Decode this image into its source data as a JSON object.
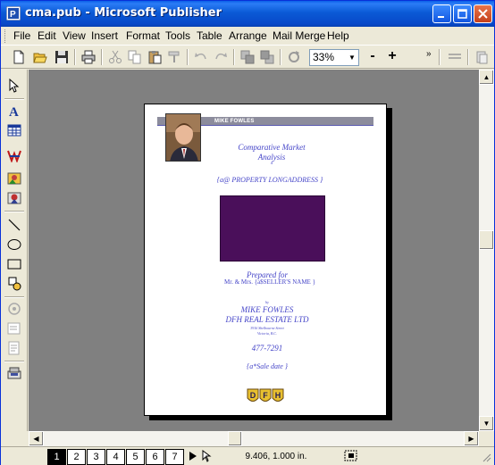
{
  "window": {
    "title": "cma.pub - Microsoft Publisher"
  },
  "menubar": {
    "items": [
      "File",
      "Edit",
      "View",
      "Insert",
      "Format",
      "Tools",
      "Table",
      "Arrange",
      "Mail Merge",
      "Help"
    ]
  },
  "toolbar": {
    "zoom": "33%",
    "zoom_out_label": "-",
    "zoom_in_label": "+"
  },
  "document": {
    "banner_name": "MIKE FOWLES",
    "title_line1": "Comparative Market",
    "title_line2": "Analysis",
    "title_line3": "4",
    "property_field": "{a@ PROPERTY LONGADDRESS        }",
    "prepared_for": "Prepared for",
    "seller_line": "Mr. & Mrs. {a$SELLER'S NAME              }",
    "by_label": "by",
    "agent_name": "MIKE FOWLES",
    "company": "DFH REAL ESTATE LTD",
    "address1": "3916 Shelbourne Street",
    "address2": "Victoria, B.C.",
    "phone": "477-7291",
    "sale_date": "{a*Sale date }",
    "logo_letters": [
      "D",
      "F",
      "H"
    ],
    "block_color": "#4a0f5a",
    "text_color": "#4545c8"
  },
  "statusbar": {
    "pages": [
      "1",
      "2",
      "3",
      "4",
      "5",
      "6",
      "7"
    ],
    "active_page": "1",
    "coordinates": "9.406, 1.000 in."
  },
  "icons": {
    "app": "publisher-icon",
    "minimize": "minimize-icon",
    "maximize": "maximize-icon",
    "close": "close-icon"
  }
}
